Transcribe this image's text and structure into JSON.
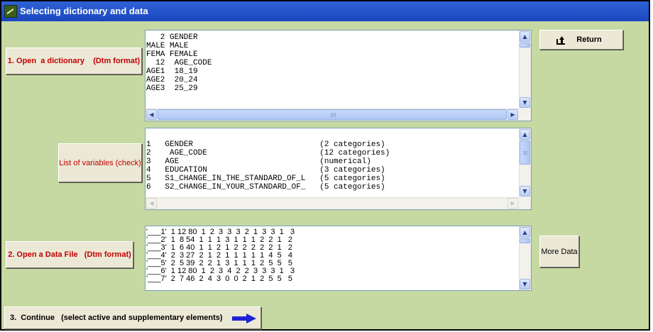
{
  "window": {
    "title": "Selecting dictionary and data"
  },
  "buttons": {
    "open_dictionary": "1. Open  a dictionary    (Dtm format)",
    "return": "Return",
    "list_variables": "List of variables (check)",
    "open_data_file": "2. Open a Data File   (Dtm format)",
    "more_data": "More Data",
    "continue": "3.  Continue   (select active and supplementary elements)"
  },
  "dictionary_box": {
    "lines": [
      "   2 GENDER",
      "MALE MALE",
      "FEMA FEMALE",
      "  12  AGE_CODE",
      "AGE1  18_19",
      "AGE2  20_24",
      "AGE3  25_29"
    ]
  },
  "variables_box": {
    "lines": [
      "1   GENDER                           (2 categories)",
      "2    AGE_CODE                        (12 categories)",
      "3   AGE                              (numerical)",
      "4   EDUCATION                        (3 categories)",
      "5   S1_CHANGE_IN_THE_STANDARD_OF_L   (5 categories)",
      "6   S2_CHANGE_IN_YOUR_STANDARD_OF_   (5 categories)"
    ]
  },
  "data_box": {
    "lines": [
      "'___1'  1 12 80  1  2  3  3  3  2  1  3  3  1   3",
      "'___2'  1  8 54  1  1  1  3  1  1  1  2  2  1   2",
      "'___3'  1  6 40  1  1  2  1  2  2  2  2  2  1   2",
      "'___4'  2  3 27  2  1  2  1  1  1  1  1  4  5   4",
      "'___5'  2  5 39  2  2  1  3  1  1  1  2  5  5   5",
      "'___6'  1 12 80  1  2  3  4  2  2  3  3  3  1   3",
      "'___7'  2  7 46  2  4  3  0  0  2  1  2  5  5   5"
    ]
  },
  "colors": {
    "background": "#c6d9a2",
    "titlebar": "#1a47c0",
    "button_text_red": "#c10000",
    "continue_arrow": "#1d23d6"
  },
  "icons": {
    "title": "app-icon",
    "return": "return-arrow-icon",
    "continue": "right-arrow-icon"
  }
}
